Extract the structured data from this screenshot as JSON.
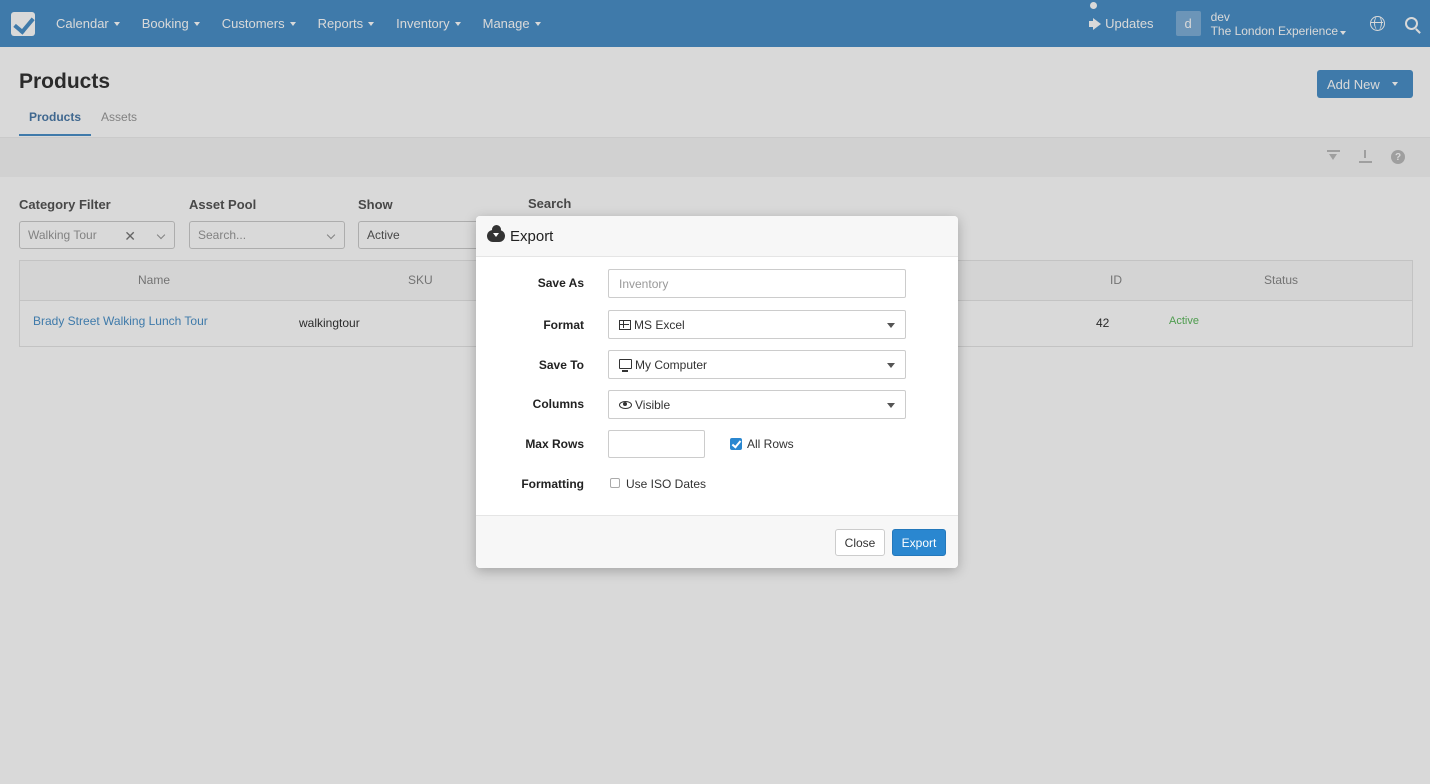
{
  "nav": {
    "items": [
      "Calendar",
      "Booking",
      "Customers",
      "Reports",
      "Inventory",
      "Manage"
    ],
    "updates": "Updates",
    "avatar_letter": "d",
    "user_name": "dev",
    "user_company": "The London Experience"
  },
  "page": {
    "title": "Products",
    "add_new": "Add New",
    "tabs": [
      "Products",
      "Assets"
    ]
  },
  "filters": {
    "category_label": "Category Filter",
    "category_value": "Walking Tour",
    "asset_pool_label": "Asset Pool",
    "asset_pool_placeholder": "Search...",
    "show_label": "Show",
    "show_value": "Active",
    "search_label": "Search"
  },
  "table": {
    "headers": {
      "name": "Name",
      "sku": "SKU",
      "id": "ID",
      "status": "Status"
    },
    "rows": [
      {
        "name": "Brady Street Walking Lunch Tour",
        "sku": "walkingtour",
        "id": "42",
        "status": "Active"
      }
    ]
  },
  "modal": {
    "title": "Export",
    "save_as_label": "Save As",
    "save_as_placeholder": "Inventory",
    "format_label": "Format",
    "format_value": "MS Excel",
    "save_to_label": "Save To",
    "save_to_value": "My Computer",
    "columns_label": "Columns",
    "columns_value": "Visible",
    "max_rows_label": "Max Rows",
    "all_rows_label": "All Rows",
    "all_rows_checked": true,
    "formatting_label": "Formatting",
    "iso_dates_label": "Use ISO Dates",
    "iso_dates_checked": false,
    "close_label": "Close",
    "export_label": "Export"
  },
  "colors": {
    "nav_bg": "#4a90c8",
    "primary": "#2a87d0"
  }
}
